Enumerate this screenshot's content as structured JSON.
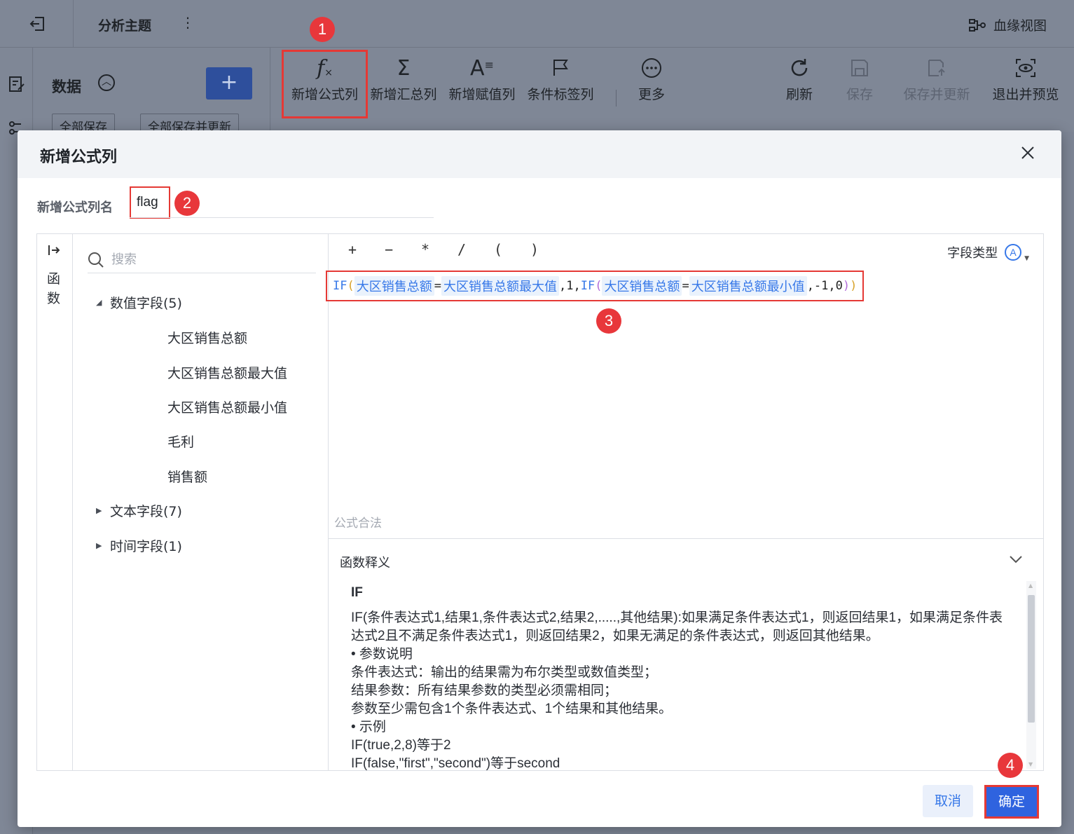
{
  "app": {
    "title": "分析主题",
    "more_menu": "⋮",
    "lineage_view": "血缘视图"
  },
  "data_panel": {
    "label": "数据",
    "add_button": "+",
    "save_all": "全部保存",
    "save_all_update": "全部保存并更新"
  },
  "toolbar": {
    "items": [
      {
        "label": "新增公式列",
        "icon": "fx-icon"
      },
      {
        "label": "新增汇总列",
        "icon": "sigma-icon"
      },
      {
        "label": "新增赋值列",
        "icon": "assign-icon"
      },
      {
        "label": "条件标签列",
        "icon": "flag-icon"
      },
      {
        "label": "更多",
        "icon": "more-circle-icon"
      },
      {
        "label": "刷新",
        "icon": "refresh-icon"
      },
      {
        "label": "保存",
        "icon": "save-icon"
      },
      {
        "label": "保存并更新",
        "icon": "save-update-icon"
      },
      {
        "label": "退出并预览",
        "icon": "preview-icon"
      }
    ]
  },
  "dialog": {
    "title": "新增公式列",
    "name_label": "新增公式列名",
    "name_value": "flag",
    "functions_tab": "函数",
    "search_placeholder": "搜索",
    "groups": {
      "numeric": "数值字段(5)",
      "text": "文本字段(7)",
      "time": "时间字段(1)"
    },
    "numeric_fields": [
      "大区销售总额",
      "大区销售总额最大值",
      "大区销售总额最小值",
      "毛利",
      "销售额"
    ],
    "operators": [
      "+",
      "−",
      "*",
      "/",
      "(",
      ")"
    ],
    "field_type_label": "字段类型",
    "field_type_icon": "Ⓐ",
    "formula": {
      "if1": "IF",
      "f1": "大区销售总额",
      "eq1": "=",
      "f2": "大区销售总额最大值",
      "sep1": ",1,",
      "if2": "IF",
      "f3": "大区销售总额",
      "eq2": "=",
      "f4": "大区销售总额最小值",
      "sep2": ",-1,0"
    },
    "formula_status": "公式合法",
    "fn_doc": {
      "header": "函数释义",
      "name": "IF",
      "lines": [
        "IF(条件表达式1,结果1,条件表达式2,结果2,.....,其他结果):如果满足条件表达式1，则返回结果1，如果满足条件表达式2且不满足条件表达式1，则返回结果2，如果无满足的条件表达式，则返回其他结果。",
        "• 参数说明",
        "条件表达式：输出的结果需为布尔类型或数值类型；",
        "结果参数：所有结果参数的类型必须需相同；",
        "参数至少需包含1个条件表达式、1个结果和其他结果。",
        "• 示例",
        "IF(true,2,8)等于2",
        "IF(false,\"first\",\"second\")等于second"
      ]
    },
    "cancel": "取消",
    "confirm": "确定"
  },
  "annotations": [
    "1",
    "2",
    "3",
    "4"
  ],
  "colors": {
    "accent": "#3778e8",
    "primary_button": "#2f63df",
    "highlight_red": "#e53935",
    "overlay": "#7d8595"
  }
}
